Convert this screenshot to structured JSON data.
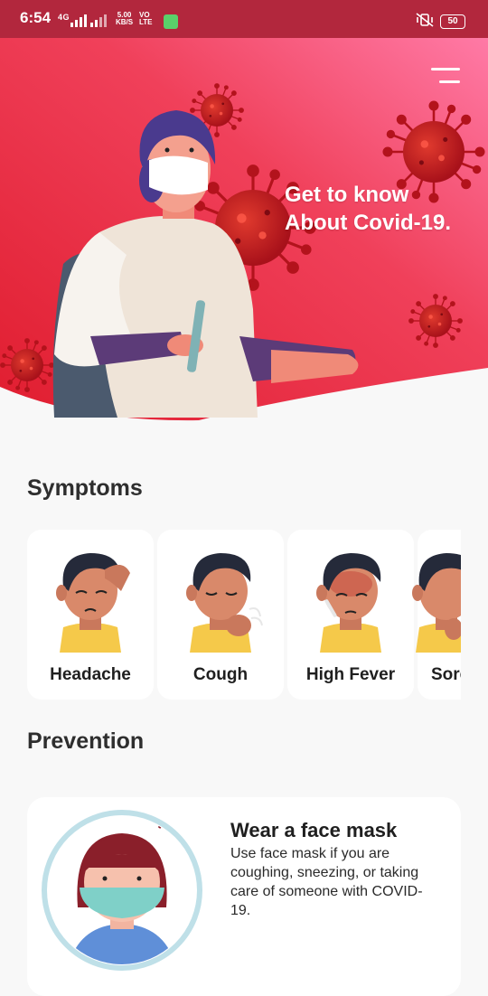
{
  "status_bar": {
    "time": "6:54",
    "network": "4G",
    "speed_value": "5.00",
    "speed_unit": "KB/S",
    "volte_top": "VO",
    "volte_bottom": "LTE",
    "battery": "50"
  },
  "hero": {
    "title_line1": "Get to know",
    "title_line2": "About Covid-19.",
    "gradient_start": "#e8243c",
    "gradient_end": "#ff7aa6"
  },
  "symptoms": {
    "heading": "Symptoms",
    "items": [
      {
        "label": "Headache"
      },
      {
        "label": "Cough"
      },
      {
        "label": "High Fever"
      },
      {
        "label": "Sore"
      }
    ]
  },
  "prevention": {
    "heading": "Prevention",
    "items": [
      {
        "title": "Wear a face mask",
        "description": "Use face mask if you are coughing, sneezing, or taking care of someone with COVID-19."
      }
    ]
  },
  "icons": {
    "menu": "hamburger-menu-icon",
    "virus": "virus-icon",
    "mute": "vibrate-mute-icon"
  }
}
